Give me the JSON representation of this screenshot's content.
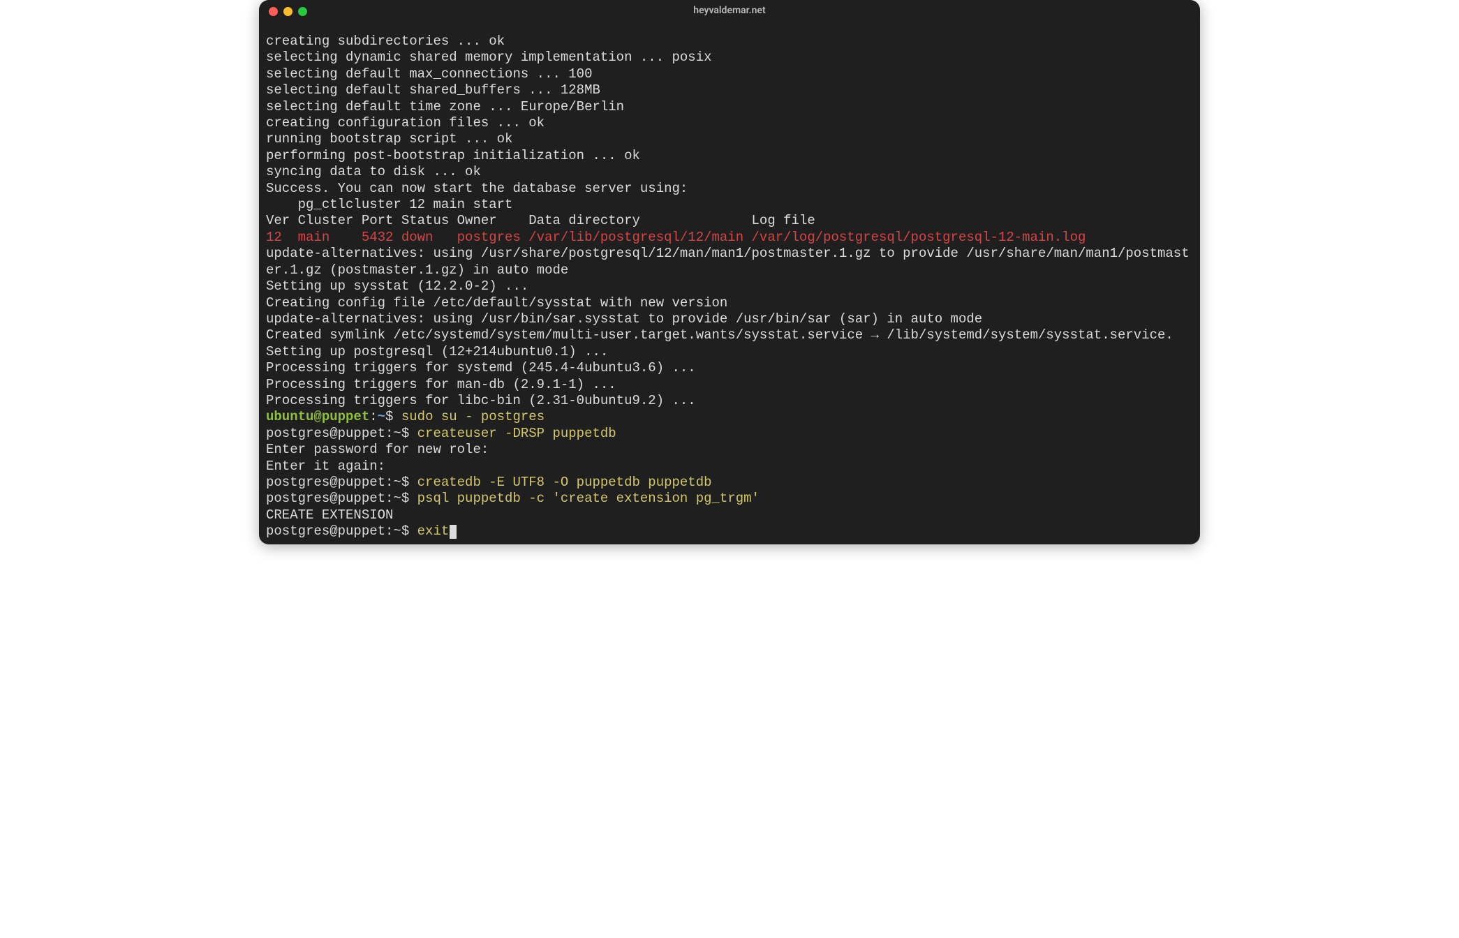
{
  "window": {
    "title": "heyvaldemar.net"
  },
  "colors": {
    "red": "#d94444",
    "yellow": "#d4c76a",
    "green": "#8fbf3f",
    "blue": "#6a9fd4",
    "fg": "#dcdcdc",
    "bg": "#1f1f1f"
  },
  "lines": [
    {
      "spans": [
        {
          "cls": "white",
          "text": "creating subdirectories ... ok"
        }
      ]
    },
    {
      "spans": [
        {
          "cls": "white",
          "text": "selecting dynamic shared memory implementation ... posix"
        }
      ]
    },
    {
      "spans": [
        {
          "cls": "white",
          "text": "selecting default max_connections ... 100"
        }
      ]
    },
    {
      "spans": [
        {
          "cls": "white",
          "text": "selecting default shared_buffers ... 128MB"
        }
      ]
    },
    {
      "spans": [
        {
          "cls": "white",
          "text": "selecting default time zone ... Europe/Berlin"
        }
      ]
    },
    {
      "spans": [
        {
          "cls": "white",
          "text": "creating configuration files ... ok"
        }
      ]
    },
    {
      "spans": [
        {
          "cls": "white",
          "text": "running bootstrap script ... ok"
        }
      ]
    },
    {
      "spans": [
        {
          "cls": "white",
          "text": "performing post-bootstrap initialization ... ok"
        }
      ]
    },
    {
      "spans": [
        {
          "cls": "white",
          "text": "syncing data to disk ... ok"
        }
      ]
    },
    {
      "spans": [
        {
          "cls": "white",
          "text": ""
        }
      ]
    },
    {
      "spans": [
        {
          "cls": "white",
          "text": "Success. You can now start the database server using:"
        }
      ]
    },
    {
      "spans": [
        {
          "cls": "white",
          "text": ""
        }
      ]
    },
    {
      "spans": [
        {
          "cls": "white",
          "text": "    pg_ctlcluster 12 main start"
        }
      ]
    },
    {
      "spans": [
        {
          "cls": "white",
          "text": ""
        }
      ]
    },
    {
      "spans": [
        {
          "cls": "white",
          "text": "Ver Cluster Port Status Owner    Data directory              Log file"
        }
      ]
    },
    {
      "spans": [
        {
          "cls": "red",
          "text": "12  main    5432 down   postgres /var/lib/postgresql/12/main /var/log/postgresql/postgresql-12-main.log"
        }
      ]
    },
    {
      "spans": [
        {
          "cls": "white",
          "text": "update-alternatives: using /usr/share/postgresql/12/man/man1/postmaster.1.gz to provide /usr/share/man/man1/postmaster.1.gz (postmaster.1.gz) in auto mode"
        }
      ]
    },
    {
      "spans": [
        {
          "cls": "white",
          "text": "Setting up sysstat (12.2.0-2) ..."
        }
      ]
    },
    {
      "spans": [
        {
          "cls": "white",
          "text": ""
        }
      ]
    },
    {
      "spans": [
        {
          "cls": "white",
          "text": "Creating config file /etc/default/sysstat with new version"
        }
      ]
    },
    {
      "spans": [
        {
          "cls": "white",
          "text": "update-alternatives: using /usr/bin/sar.sysstat to provide /usr/bin/sar (sar) in auto mode"
        }
      ]
    },
    {
      "spans": [
        {
          "cls": "white",
          "text": "Created symlink /etc/systemd/system/multi-user.target.wants/sysstat.service → /lib/systemd/system/sysstat.service."
        }
      ]
    },
    {
      "spans": [
        {
          "cls": "white",
          "text": "Setting up postgresql (12+214ubuntu0.1) ..."
        }
      ]
    },
    {
      "spans": [
        {
          "cls": "white",
          "text": "Processing triggers for systemd (245.4-4ubuntu3.6) ..."
        }
      ]
    },
    {
      "spans": [
        {
          "cls": "white",
          "text": "Processing triggers for man-db (2.9.1-1) ..."
        }
      ]
    },
    {
      "spans": [
        {
          "cls": "white",
          "text": "Processing triggers for libc-bin (2.31-0ubuntu9.2) ..."
        }
      ]
    },
    {
      "spans": [
        {
          "cls": "green",
          "text": "ubuntu@puppet"
        },
        {
          "cls": "white",
          "text": ":"
        },
        {
          "cls": "blue",
          "text": "~"
        },
        {
          "cls": "white",
          "text": "$ "
        },
        {
          "cls": "yellow",
          "text": "sudo su - postgres"
        }
      ]
    },
    {
      "spans": [
        {
          "cls": "white",
          "text": "postgres@puppet:~$ "
        },
        {
          "cls": "yellow",
          "text": "createuser -DRSP puppetdb"
        }
      ]
    },
    {
      "spans": [
        {
          "cls": "white",
          "text": "Enter password for new role:"
        }
      ]
    },
    {
      "spans": [
        {
          "cls": "white",
          "text": "Enter it again:"
        }
      ]
    },
    {
      "spans": [
        {
          "cls": "white",
          "text": "postgres@puppet:~$ "
        },
        {
          "cls": "yellow",
          "text": "createdb -E UTF8 -O puppetdb puppetdb"
        }
      ]
    },
    {
      "spans": [
        {
          "cls": "white",
          "text": "postgres@puppet:~$ "
        },
        {
          "cls": "yellow",
          "text": "psql puppetdb -c 'create extension pg_trgm'"
        }
      ]
    },
    {
      "spans": [
        {
          "cls": "white",
          "text": "CREATE EXTENSION"
        }
      ]
    },
    {
      "spans": [
        {
          "cls": "white",
          "text": "postgres@puppet:~$ "
        },
        {
          "cls": "yellow",
          "text": "exit"
        }
      ],
      "cursor": true
    }
  ]
}
